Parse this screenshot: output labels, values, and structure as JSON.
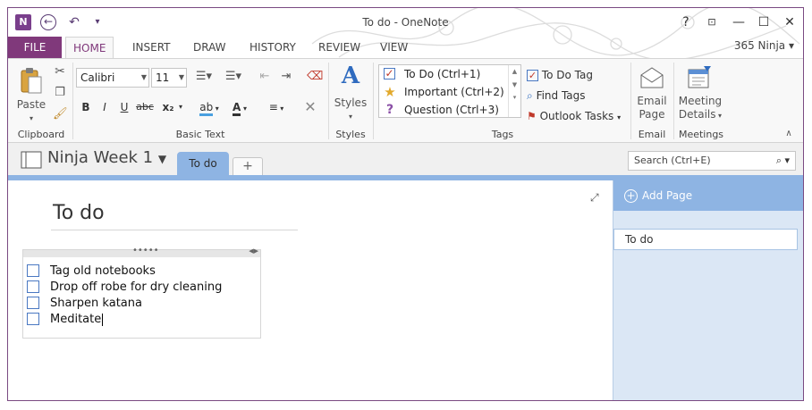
{
  "titlebar": {
    "title": "To do - OneNote",
    "help": "?",
    "minimize": "—",
    "maximize": "☐",
    "close": "✕",
    "app_icon": "N",
    "back_icon": "back-arrow-icon",
    "undo_icon": "undo-icon"
  },
  "ribbon_tabs": {
    "file": "FILE",
    "tabs": [
      "HOME",
      "INSERT",
      "DRAW",
      "HISTORY",
      "REVIEW",
      "VIEW"
    ],
    "active": "HOME",
    "user": "365 Ninja"
  },
  "clipboard": {
    "paste": "Paste",
    "group": "Clipboard"
  },
  "basic_text": {
    "font": "Calibri",
    "size": "11",
    "bold": "B",
    "italic": "I",
    "underline": "U",
    "strike": "abc",
    "subscript": "x₂",
    "group": "Basic Text"
  },
  "styles": {
    "label": "Styles",
    "group": "Styles"
  },
  "tags": {
    "items": [
      {
        "label": "To Do (Ctrl+1)",
        "icon": "checkbox-icon"
      },
      {
        "label": "Important (Ctrl+2)",
        "icon": "star-icon"
      },
      {
        "label": "Question (Ctrl+3)",
        "icon": "question-icon"
      }
    ],
    "todo_tag": "To Do Tag",
    "find_tags": "Find Tags",
    "outlook_tasks": "Outlook Tasks",
    "group": "Tags"
  },
  "email": {
    "line1": "Email",
    "line2": "Page",
    "group": "Email"
  },
  "meetings": {
    "line1": "Meeting",
    "line2": "Details",
    "group": "Meetings"
  },
  "notebook": {
    "name": "Ninja Week 1",
    "section": "To do",
    "add_section": "+",
    "search_placeholder": "Search (Ctrl+E)"
  },
  "page": {
    "title": "To do",
    "todos": [
      "Tag old notebooks",
      "Drop off robe for dry cleaning",
      "Sharpen katana",
      "Meditate"
    ]
  },
  "pages_pane": {
    "add_page": "Add Page",
    "pages": [
      "To do"
    ]
  },
  "colors": {
    "accent": "#80397b",
    "section": "#8eb4e3",
    "pane": "#dbe7f5"
  }
}
